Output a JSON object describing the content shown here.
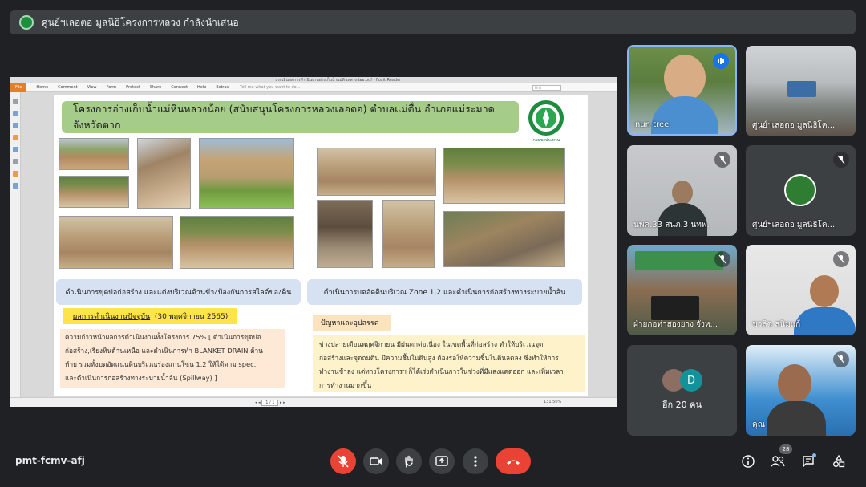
{
  "topbar": {
    "title": "ศูนย์ฯเลอตอ มูลนิธิโครงการหลวง กำลังนำเสนอ"
  },
  "reader": {
    "doc_title": "ประเมินผลการดำเนินงานอ่างเก็บน้ำแม่หินหลวงน้อย.pdf - Foxit Reader",
    "menu": [
      "File",
      "Home",
      "Comment",
      "View",
      "Form",
      "Protect",
      "Share",
      "Connect",
      "Help",
      "Extras"
    ],
    "tell_me": "Tell me what you want to do...",
    "find_placeholder": "Find",
    "page_indicator": "1 / 1",
    "zoom": "131.50%"
  },
  "slide": {
    "title": "โครงการอ่างเก็บน้ำแม่หินหลวงน้อย (สนับสนุนโครงการหลวงเลอตอ) ตำบลแม่ตื่น อำเภอแม่ระมาด จังหวัดตาก",
    "logo_caption": "กรมชลประทาน",
    "caption_left": "ดำเนินการขุดบ่อก่อสร้าง และแต่งบริเวณด้านข้างป้องกันการสไลด์ของดิน",
    "caption_right": "ดำเนินการบดอัดดินบริเวณ Zone 1,2 และดำเนินการก่อสร้างทางระบายน้ำล้น",
    "progress_tag": "ผลการดำเนินงานปัจจุบัน",
    "progress_date": "(30 พฤศจิกายน 2565)",
    "progress_lines": [
      "ความก้าวหน้าผลการดำเนินงานทั้งโครงการ   75% [ ดำเนินการขุดบ่อ",
      "ก่อสร้าง,เรียงหินด้านเหนือ และดำเนินการทำ BLANKET DRAIN ด้าน",
      "ท้าย  รวมทั้งบดอัดแน่นดินบริเวณร่องแกนโซน  1,2  ให้ได้ตาม  spec.",
      "และดำเนินการก่อสร้างทางระบายน้ำล้น (Spillway) ]"
    ],
    "problem_tag": "ปัญหาและอุปสรรค",
    "problem_lines": [
      "ช่วงปลายเดือนพฤศจิกายน   มีฝนตกต่อเนื่อง   ในเขตพื้นที่ก่อสร้าง   ทำให้บริเวณจุด",
      "ก่อสร้างและจุดถมดิน  มีความชื้นในดินสูง  ต้องรอให้ความชื้นในดินลดลง  ซึ่งทำให้การ",
      "ทำงานช้าลง  แต่ทางโครงการฯ  ก็ได้เร่งดำเนินการในช่วงที่มีแสงแดดออก  และเพิ่มเวลา",
      "การทำงานมากขึ้น"
    ]
  },
  "participants": [
    {
      "name": "nun tree",
      "status": "speaking"
    },
    {
      "name": "ศูนย์ฯเลอตอ มูลนิธิโค...",
      "status": "video"
    },
    {
      "name": "นพค.33 สนภ.3 นทพ.",
      "status": "muted"
    },
    {
      "name": "ศูนย์ฯเลอตอ มูลนิธิโค...",
      "status": "muted"
    },
    {
      "name": "ฝ่ายกอท่าสองยาง จังห...",
      "status": "muted"
    },
    {
      "name": "ชวลิต สนิมแก้",
      "status": "muted"
    },
    {
      "name": "อีก 20 คน",
      "avatar_letter": "D"
    },
    {
      "name": "คุณ",
      "status": "muted"
    }
  ],
  "bottombar": {
    "meeting_code": "pmt-fcmv-afj",
    "participant_count": "28"
  },
  "colors": {
    "accent_blue": "#8ab4f8",
    "end_call_red": "#ea4335",
    "slide_title_green": "#a6cc8a",
    "highlight_yellow": "#ffe34a"
  }
}
